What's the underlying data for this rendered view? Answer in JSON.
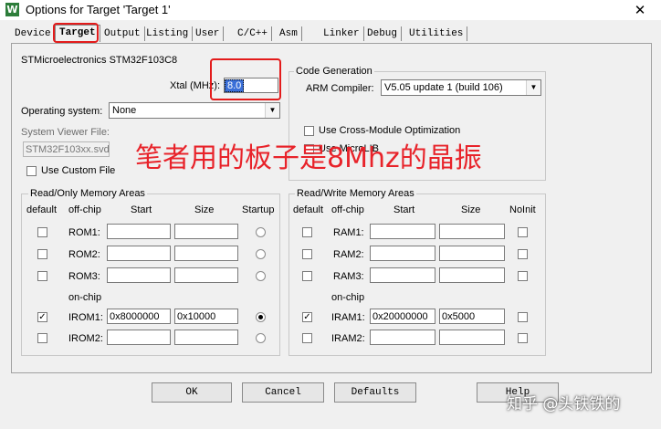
{
  "window": {
    "title": "Options for Target 'Target 1'",
    "close_glyph": "✕",
    "app_icon": "W"
  },
  "tabs": [
    "Device",
    "Target",
    "Output",
    "Listing",
    "User",
    "C/C++",
    "Asm",
    "Linker",
    "Debug",
    "Utilities"
  ],
  "device": {
    "name": "STMicroelectronics STM32F103C8",
    "xtal_label": "Xtal (MHz):",
    "xtal_value": "8.0",
    "os_label": "Operating system:",
    "os_value": "None",
    "svf_label": "System Viewer File:",
    "svf_value": "STM32F103xx.svd",
    "use_custom_file": "Use Custom File"
  },
  "code_generation": {
    "title": "Code Generation",
    "compiler_label": "ARM Compiler:",
    "compiler_value": "V5.05 update 1 (build 106)",
    "cross_module": "Use Cross-Module Optimization",
    "microlib": "Use MicroLIB"
  },
  "readonly": {
    "title": "Read/Only Memory Areas",
    "headers": {
      "default": "default",
      "offchip": "off-chip",
      "start": "Start",
      "size": "Size",
      "startup": "Startup"
    },
    "onchip_label": "on-chip",
    "rows": [
      {
        "name": "ROM1:",
        "start": "",
        "size": ""
      },
      {
        "name": "ROM2:",
        "start": "",
        "size": ""
      },
      {
        "name": "ROM3:",
        "start": "",
        "size": ""
      },
      {
        "name": "IROM1:",
        "start": "0x8000000",
        "size": "0x10000"
      },
      {
        "name": "IROM2:",
        "start": "",
        "size": ""
      }
    ]
  },
  "readwrite": {
    "title": "Read/Write Memory Areas",
    "headers": {
      "default": "default",
      "offchip": "off-chip",
      "start": "Start",
      "size": "Size",
      "noinit": "NoInit"
    },
    "onchip_label": "on-chip",
    "rows": [
      {
        "name": "RAM1:",
        "start": "",
        "size": ""
      },
      {
        "name": "RAM2:",
        "start": "",
        "size": ""
      },
      {
        "name": "RAM3:",
        "start": "",
        "size": ""
      },
      {
        "name": "IRAM1:",
        "start": "0x20000000",
        "size": "0x5000"
      },
      {
        "name": "IRAM2:",
        "start": "",
        "size": ""
      }
    ]
  },
  "buttons": {
    "ok": "OK",
    "cancel": "Cancel",
    "defaults": "Defaults",
    "help": "Help"
  },
  "annotation": "笔者用的板子是8Mhz的晶振",
  "watermark": "知乎 @头铁铁的",
  "colors": {
    "annotation": "#e8232a"
  }
}
